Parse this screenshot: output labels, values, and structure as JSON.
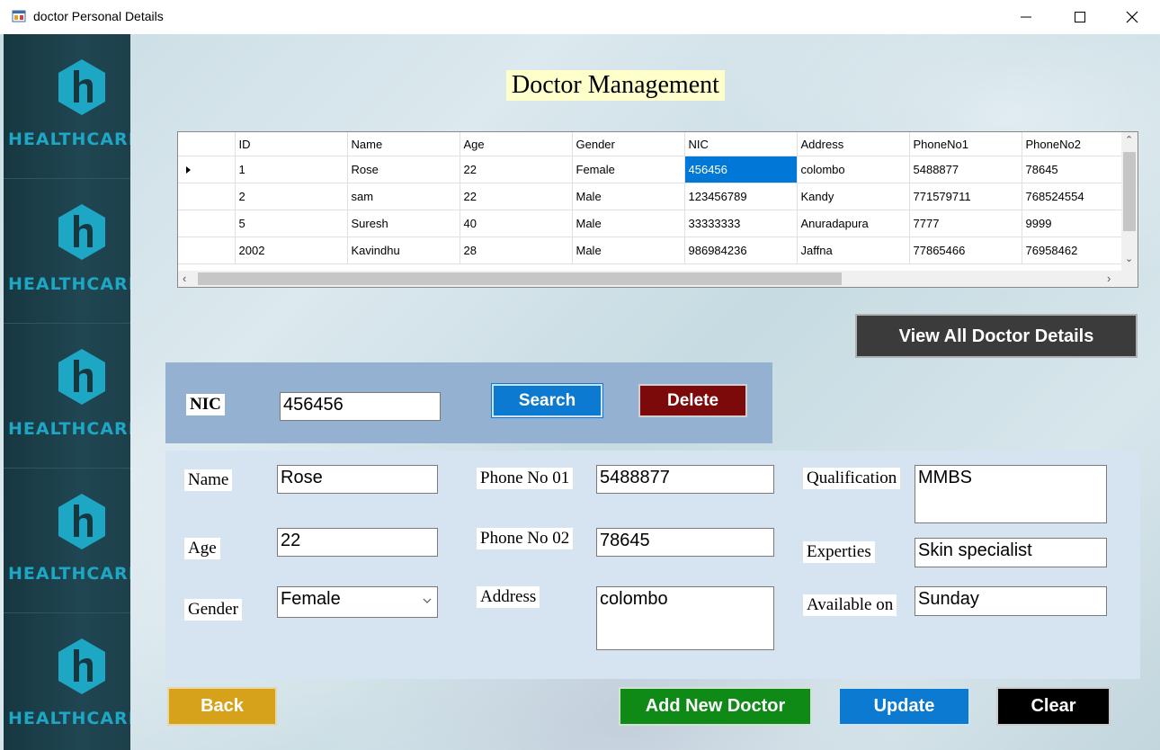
{
  "window": {
    "title": "doctor Personal Details"
  },
  "icons": {
    "app": "app-window-icon",
    "minimize": "minimize-icon",
    "maximize": "maximize-icon",
    "close": "close-icon",
    "logo": "healthcare-logo-icon"
  },
  "sidebar": {
    "logo_text": "HEALTHCARE"
  },
  "heading": "Doctor Management",
  "grid": {
    "columns": [
      "ID",
      "Name",
      "Age",
      "Gender",
      "NIC",
      "Address",
      "PhoneNo1",
      "PhoneNo2"
    ],
    "rows": [
      [
        "1",
        "Rose",
        "22",
        "Female",
        "456456",
        "colombo",
        "5488877",
        "78645"
      ],
      [
        "2",
        "sam",
        "22",
        "Male",
        "123456789",
        "Kandy",
        "771579711",
        "768524554"
      ],
      [
        "5",
        "Suresh",
        "40",
        "Male",
        "33333333",
        "Anuradapura",
        "7777",
        "9999"
      ],
      [
        "2002",
        "Kavindhu",
        "28",
        "Male",
        "986984236",
        "Jaffna",
        "77865466",
        "76958462"
      ]
    ]
  },
  "buttons": {
    "view_all": "View All Doctor Details",
    "search": "Search",
    "delete": "Delete",
    "back": "Back",
    "add": "Add New Doctor",
    "update": "Update",
    "clear": "Clear"
  },
  "search": {
    "label": "NIC",
    "value": "456456"
  },
  "form": {
    "name_label": "Name",
    "name_value": "Rose",
    "age_label": "Age",
    "age_value": "22",
    "gender_label": "Gender",
    "gender_value": "Female",
    "phone1_label": "Phone No 01",
    "phone1_value": "5488877",
    "phone2_label": "Phone No 02",
    "phone2_value": "78645",
    "address_label": "Address",
    "address_value": "colombo",
    "qualification_label": "Qualification",
    "qualification_value": "MMBS",
    "experties_label": "Experties",
    "experties_value": "Skin specialist",
    "available_label": "Available on",
    "available_value": "Sunday"
  },
  "colors": {
    "sidebar": "#1d404b",
    "logo": "#1ea7c4",
    "selection": "#0078d7",
    "search_panel": "#94b1d1",
    "form_panel": "#d6e4f2"
  }
}
